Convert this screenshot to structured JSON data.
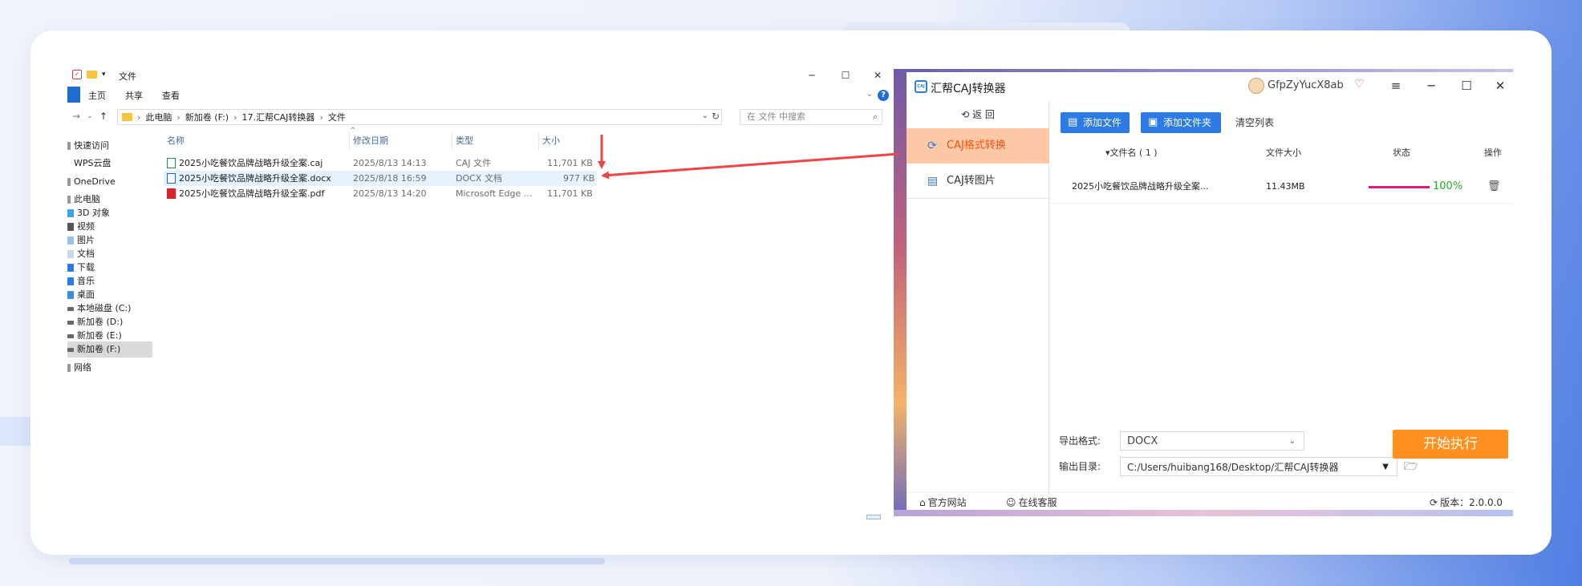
{
  "explorer": {
    "title": "文件",
    "ribbon_tabs": [
      "主页",
      "共享",
      "查看"
    ],
    "breadcrumbs": [
      "此电脑",
      "新加卷 (F:)",
      "17.汇帮CAJ转换器",
      "文件"
    ],
    "search_placeholder": "在 文件 中搜索",
    "nav_items": [
      "快速访问",
      "WPS云盘",
      "OneDrive",
      "此电脑",
      "3D 对象",
      "视频",
      "图片",
      "文档",
      "下载",
      "音乐",
      "桌面",
      "本地磁盘 (C:)",
      "新加卷 (D:)",
      "新加卷 (E:)",
      "新加卷 (F:)",
      "网络"
    ],
    "columns": [
      "名称",
      "修改日期",
      "类型",
      "大小"
    ],
    "files": [
      {
        "name": "2025小吃餐饮品牌战略升级全案.caj",
        "date": "2025/8/13 14:13",
        "type": "CAJ 文件",
        "size": "11,701 KB",
        "icon": "caj-file-icon"
      },
      {
        "name": "2025小吃餐饮品牌战略升级全案.docx",
        "date": "2025/8/18 16:59",
        "type": "DOCX 文档",
        "size": "977 KB",
        "icon": "docx-file-icon"
      },
      {
        "name": "2025小吃餐饮品牌战略升级全案.pdf",
        "date": "2025/8/13 14:20",
        "type": "Microsoft Edge ...",
        "size": "11,701 KB",
        "icon": "pdf-file-icon"
      }
    ]
  },
  "converter": {
    "app_name": "汇帮CAJ转换器",
    "username": "GfpZyYucX8ab",
    "back_label": "返 回",
    "sidebar": [
      "CAJ格式转换",
      "CAJ转图片"
    ],
    "add_file": "添加文件",
    "add_folder": "添加文件夹",
    "clear_list": "清空列表",
    "table_headers": {
      "name": "文件名 ( 1 )",
      "size": "文件大小",
      "status": "状态",
      "action": "操作"
    },
    "row": {
      "name": "2025小吃餐饮品牌战略升级全案...",
      "size": "11.43MB",
      "progress": 1.0,
      "percent": "100%"
    },
    "export_format_label": "导出格式:",
    "export_format": "DOCX",
    "output_dir_label": "输出目录:",
    "output_dir": "C:/Users/huibang168/Desktop/汇帮CAJ转换器",
    "start_button": "开始执行",
    "footer": {
      "official_site": "官方网站",
      "online_service": "在线客服",
      "version": "版本：2.0.0.0"
    }
  },
  "colors": {
    "accent_blue": "#2d7be5",
    "start_orange": "#ff8f1e",
    "active_tab": "#fdc8a5",
    "arrow_red": "#f04545",
    "progress": "#e6197b",
    "percent_green": "#2fa82c"
  }
}
